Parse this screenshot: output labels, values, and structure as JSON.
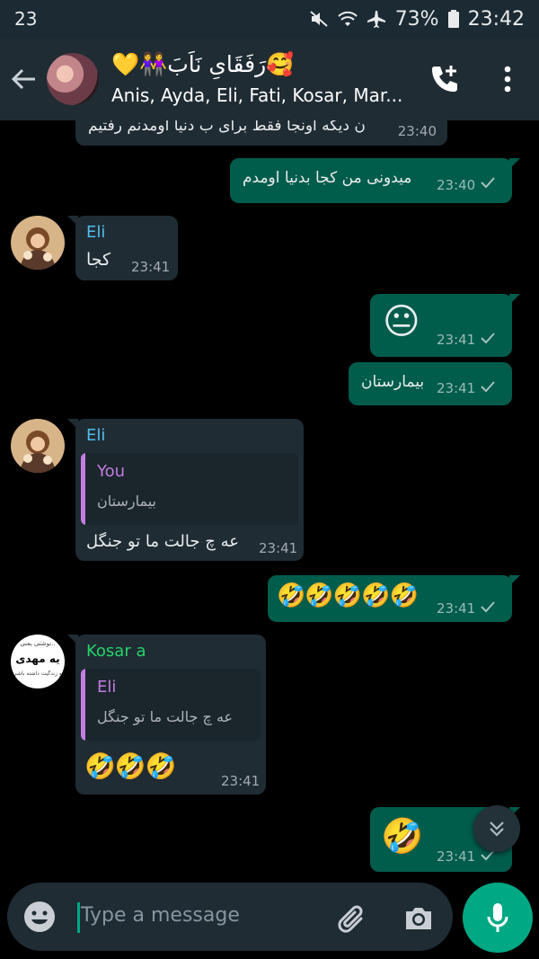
{
  "status_bar": {
    "notification_count": "23",
    "battery": "73%",
    "time": "23:42"
  },
  "header": {
    "title": "رَفَقَاىِ نَاَبَ",
    "title_emoji_before": "💛👭",
    "title_emoji_after": "🥰",
    "members": "Anis, Ayda, Eli, Fati, Kosar, Mar..."
  },
  "messages": [
    {
      "dir": "in",
      "text": "ن دیگه اونجا فقط برای ب دنیا اومدنم رفتیم",
      "time": "23:40"
    },
    {
      "dir": "out",
      "text": "میدونی من کجا بدنیا اومدم",
      "time": "23:40"
    },
    {
      "dir": "in",
      "sender": "Eli",
      "text": "کجا",
      "time": "23:41"
    },
    {
      "dir": "out",
      "emoji": "😐",
      "time": "23:41"
    },
    {
      "dir": "out",
      "text": "بیمارستان",
      "time": "23:41"
    },
    {
      "dir": "in",
      "sender": "Eli",
      "quote_name": "You",
      "quote_text": "بیمارستان",
      "text": "عه چ جالت ما تو جنگل",
      "time": "23:41"
    },
    {
      "dir": "out",
      "emoji": "🤣🤣🤣🤣🤣",
      "time": "23:41"
    },
    {
      "dir": "in",
      "sender": "Kosar a",
      "quote_name": "Eli",
      "quote_text": "عه چ جالت ما تو جنگل",
      "emoji": "🤣🤣🤣",
      "time": "23:41"
    },
    {
      "dir": "out",
      "emoji": "🤣",
      "time": "23:41"
    }
  ],
  "kosar_avatar": {
    "line1": "نوشتی یعنی..",
    "line2": "یه مهدی",
    "line3": "تو زندگیت داشته باشی"
  },
  "composer": {
    "placeholder": "Type a message"
  },
  "colors": {
    "incoming": "#1f2c34",
    "outgoing": "#005c4b",
    "accent": "#00a884",
    "eli_name": "#53bdeb",
    "kosar_name": "#25d366",
    "quote_name": "#c27ee0"
  }
}
